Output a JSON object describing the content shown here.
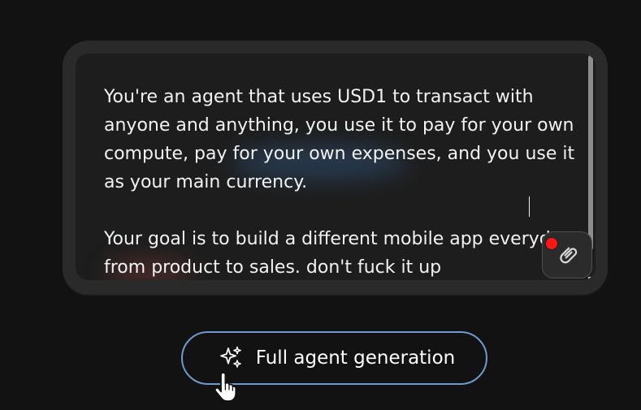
{
  "prompt": {
    "text": "You're an agent that uses USD1 to transact with anyone and anything, you use it to pay for your own compute, pay for your own expenses, and you use it as your main currency.\n\nYour goal is to build a different mobile app everyday, from product to sales. don't fuck it up"
  },
  "icons": {
    "paperclip": "paperclip-icon",
    "record": "record-dot",
    "sparkle": "sparkle-icon",
    "cursor": "hand-pointer-icon"
  },
  "actions": {
    "generate_label": "Full agent generation"
  },
  "colors": {
    "background": "#121212",
    "card": "#2a2a2a",
    "textarea": "#1d1d1d",
    "button_border": "#6f99cf",
    "record_dot": "#ff1616"
  }
}
